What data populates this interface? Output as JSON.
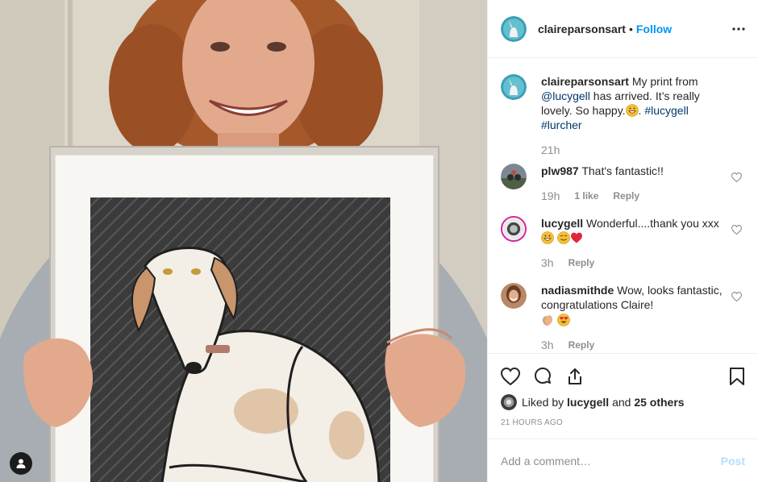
{
  "post": {
    "author": "claireparsonsart",
    "separator": "•",
    "follow_label": "Follow",
    "more_icon": "more-options-icon"
  },
  "caption": {
    "user": "claireparsonsart",
    "text_1": "My print from ",
    "mention": "@lucygell",
    "text_2": " has arrived. It’s really lovely. So happy.",
    "text_3": ". ",
    "hashtag_1": "#lucygell",
    "hashtag_2": "#lurcher",
    "time": "21h"
  },
  "comments": [
    {
      "user": "plw987",
      "text": "That's fantastic!!",
      "time": "19h",
      "likes": "1 like",
      "reply": "Reply"
    },
    {
      "user": "lucygell",
      "text": "Wonderful....thank you xxx",
      "time": "3h",
      "reply": "Reply"
    },
    {
      "user": "nadiasmithde",
      "text": "Wow, looks fantastic, congratulations Claire!",
      "time": "3h",
      "reply": "Reply"
    }
  ],
  "likes": {
    "prefix": "Liked by ",
    "user": "lucygell",
    "middle": " and ",
    "others": "25 others"
  },
  "timestamp": "21 HOURS AGO",
  "add_comment": {
    "placeholder": "Add a comment…",
    "post_label": "Post"
  },
  "colors": {
    "accent": "#0095f6",
    "post_disabled": "#b2dffc",
    "muted": "#8e8e8e"
  }
}
